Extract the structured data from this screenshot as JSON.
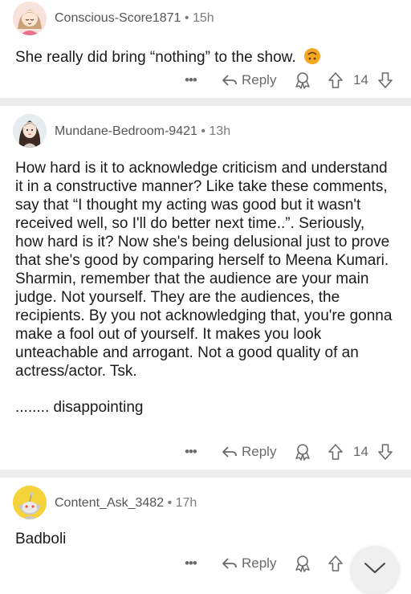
{
  "comments": [
    {
      "username": "Conscious-Score1871",
      "age": "15h",
      "text": [
        "She really did bring “nothing” to the show."
      ],
      "emoji": "upside-down-face",
      "more_label": "•••",
      "reply_label": "Reply",
      "votes": "14"
    },
    {
      "username": "Mundane-Bedroom-9421",
      "age": "13h",
      "text": [
        "How hard is it to acknowledge criticism and understand it in a constructive manner? Like take these comments, say that “I thought my acting was good but it wasn't received well, so I'll do better next time..”. Seriously, how hard is it? Now she's being delusional just to prove that she's good by comparing herself to Meena Kumari. Sharmin, remember that the audience are your main judge. Not yourself. They are the audiences, the recipients. By you not acknowledging that, you're gonna make a fool out of yourself. It makes you look unteachable and arrogant. Not a good quality of an actress/actor. Tsk.",
        "........ disappointing"
      ],
      "more_label": "•••",
      "reply_label": "Reply",
      "votes": "14"
    },
    {
      "username": "Content_Ask_3482",
      "age": "17h",
      "text": [
        "Badboli"
      ],
      "more_label": "•••",
      "reply_label": "Reply",
      "votes": ""
    }
  ],
  "meta_separator": "•",
  "colors": {
    "separator": "#ececec",
    "meta": "#7c7c7c",
    "action": "#6a6a6a",
    "emoji": "#f5a623"
  },
  "icons": [
    "reply-arrow-icon",
    "award-icon",
    "upvote-arrow-icon",
    "downvote-arrow-icon",
    "chevron-down-icon",
    "upside-down-face-emoji"
  ]
}
